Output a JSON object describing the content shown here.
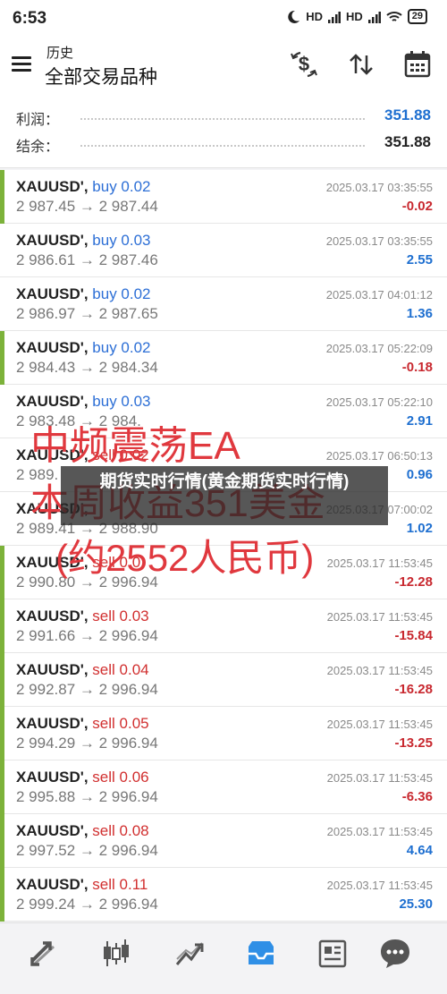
{
  "status_bar": {
    "time": "6:53",
    "signal_1": "HD",
    "signal_2": "HD",
    "battery": "29"
  },
  "header": {
    "subtitle": "历史",
    "title": "全部交易品种",
    "actions": [
      "dollar-refresh-icon",
      "sort-icon",
      "calendar-icon"
    ]
  },
  "summary": {
    "profit_label": "利润：",
    "profit_value": "351.88",
    "balance_label": "结余：",
    "balance_value": "351.88"
  },
  "trades": [
    {
      "symbol": "XAUUSD',",
      "side": "buy 0.02",
      "prices": "2 987.45 → 2 987.44",
      "date": "2025.03.17 03:35:55",
      "profit": "-0.02"
    },
    {
      "symbol": "XAUUSD',",
      "side": "buy 0.03",
      "prices": "2 986.61 → 2 987.46",
      "date": "2025.03.17 03:35:55",
      "profit": "2.55"
    },
    {
      "symbol": "XAUUSD',",
      "side": "buy 0.02",
      "prices": "2 986.97 → 2 987.65",
      "date": "2025.03.17 04:01:12",
      "profit": "1.36"
    },
    {
      "symbol": "XAUUSD',",
      "side": "buy 0.02",
      "prices": "2 984.43 → 2 984.34",
      "date": "2025.03.17 05:22:09",
      "profit": "-0.18"
    },
    {
      "symbol": "XAUUSD',",
      "side": "buy 0.03",
      "prices": "2 983.48 → 2 984.",
      "date": "2025.03.17 05:22:10",
      "profit": "2.91"
    },
    {
      "symbol": "XAUUSD',",
      "side": "sell 0.02",
      "prices": "2 989.",
      "date": "2025.03.17 06:50:13",
      "profit": "0.96"
    },
    {
      "symbol": "XAUUSD',",
      "side": "",
      "prices": "2 989.41 → 2 988.90",
      "date": "2025.03.17 07:00:02",
      "profit": "1.02"
    },
    {
      "symbol": "XAUUSD',",
      "side": "sell 0.0",
      "prices": "2 990.80 → 2 996.94",
      "date": "2025.03.17 11:53:45",
      "profit": "-12.28"
    },
    {
      "symbol": "XAUUSD',",
      "side": "sell 0.03",
      "prices": "2 991.66 → 2 996.94",
      "date": "2025.03.17 11:53:45",
      "profit": "-15.84"
    },
    {
      "symbol": "XAUUSD',",
      "side": "sell 0.04",
      "prices": "2 992.87 → 2 996.94",
      "date": "2025.03.17 11:53:45",
      "profit": "-16.28"
    },
    {
      "symbol": "XAUUSD',",
      "side": "sell 0.05",
      "prices": "2 994.29 → 2 996.94",
      "date": "2025.03.17 11:53:45",
      "profit": "-13.25"
    },
    {
      "symbol": "XAUUSD',",
      "side": "sell 0.06",
      "prices": "2 995.88 → 2 996.94",
      "date": "2025.03.17 11:53:45",
      "profit": "-6.36"
    },
    {
      "symbol": "XAUUSD',",
      "side": "sell 0.08",
      "prices": "2 997.52 → 2 996.94",
      "date": "2025.03.17 11:53:45",
      "profit": "4.64"
    },
    {
      "symbol": "XAUUSD',",
      "side": "sell 0.11",
      "prices": "2 999.24 → 2 996.94",
      "date": "2025.03.17 11:53:45",
      "profit": "25.30"
    }
  ],
  "overlay": {
    "line1": "中频震荡EA",
    "line2": "本周收益351美金",
    "line3": "(约2552人民币)",
    "banner": "期货实时行情(黄金期货实时行情)"
  },
  "bottom_nav": [
    "trade-icon",
    "chart-icon",
    "quotes-trend-icon",
    "history-inbox-icon",
    "news-icon",
    "messages-icon"
  ],
  "colors": {
    "buy": "#2d6fd6",
    "sell": "#d12f2f",
    "positive": "#1e6fd0",
    "negative": "#c8282f",
    "bar_green": "#7cb23a",
    "overlay_red": "#e0383e",
    "active_nav": "#2f8fe6"
  }
}
